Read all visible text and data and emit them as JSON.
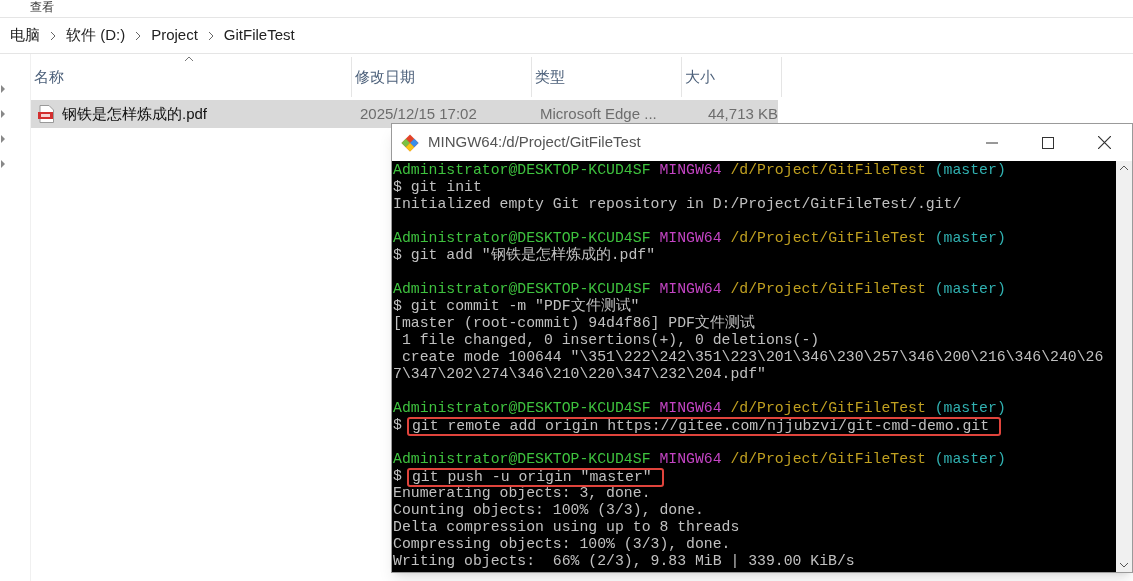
{
  "explorer": {
    "menu_label": "查看",
    "breadcrumbs": [
      "电脑",
      "软件 (D:)",
      "Project",
      "GitFileTest"
    ],
    "nav_items": [
      {
        "expanded": false
      },
      {
        "expanded": false
      },
      {
        "expanded": false
      },
      {
        "expanded": false
      }
    ],
    "columns": [
      {
        "label": "名称",
        "sorted": true
      },
      {
        "label": "修改日期",
        "sorted": false
      },
      {
        "label": "类型",
        "sorted": false
      },
      {
        "label": "大小",
        "sorted": false
      }
    ],
    "files": [
      {
        "name": "钢铁是怎样炼成的.pdf",
        "modified": "2025/12/15 17:02",
        "type": "Microsoft Edge ...",
        "size": "44,713 KB",
        "selected": true
      }
    ]
  },
  "terminal": {
    "title": "MINGW64:/d/Project/GitFileTest",
    "lines": [
      {
        "kind": "prompt",
        "user": "Administrator@DESKTOP-KCUD4SF",
        "system": "MINGW64",
        "path": "/d/Project/GitFileTest",
        "branch": "(master)"
      },
      {
        "kind": "command",
        "prompt": "$",
        "command": "git init",
        "highlighted": false
      },
      {
        "kind": "output",
        "text": "Initialized empty Git repository in D:/Project/GitFileTest/.git/"
      },
      {
        "kind": "blank"
      },
      {
        "kind": "prompt",
        "user": "Administrator@DESKTOP-KCUD4SF",
        "system": "MINGW64",
        "path": "/d/Project/GitFileTest",
        "branch": "(master)"
      },
      {
        "kind": "command",
        "prompt": "$",
        "command": "git add \"钢铁是怎样炼成的.pdf\"",
        "highlighted": false
      },
      {
        "kind": "blank"
      },
      {
        "kind": "prompt",
        "user": "Administrator@DESKTOP-KCUD4SF",
        "system": "MINGW64",
        "path": "/d/Project/GitFileTest",
        "branch": "(master)"
      },
      {
        "kind": "command",
        "prompt": "$",
        "command": "git commit -m \"PDF文件测试\"",
        "highlighted": false
      },
      {
        "kind": "output",
        "text": "[master (root-commit) 94d4f86] PDF文件测试"
      },
      {
        "kind": "output",
        "text": " 1 file changed, 0 insertions(+), 0 deletions(-)"
      },
      {
        "kind": "output",
        "text": " create mode 100644 \"\\351\\222\\242\\351\\223\\201\\346\\230\\257\\346\\200\\216\\346\\240\\26"
      },
      {
        "kind": "output",
        "text": "7\\347\\202\\274\\346\\210\\220\\347\\232\\204.pdf\""
      },
      {
        "kind": "blank"
      },
      {
        "kind": "prompt",
        "user": "Administrator@DESKTOP-KCUD4SF",
        "system": "MINGW64",
        "path": "/d/Project/GitFileTest",
        "branch": "(master)"
      },
      {
        "kind": "command",
        "prompt": "$",
        "command": "git remote add origin https://gitee.com/njjubzvi/git-cmd-demo.git",
        "highlighted": true
      },
      {
        "kind": "blank"
      },
      {
        "kind": "prompt",
        "user": "Administrator@DESKTOP-KCUD4SF",
        "system": "MINGW64",
        "path": "/d/Project/GitFileTest",
        "branch": "(master)"
      },
      {
        "kind": "command",
        "prompt": "$",
        "command": "git push -u origin \"master\"",
        "highlighted": true
      },
      {
        "kind": "output",
        "text": "Enumerating objects: 3, done."
      },
      {
        "kind": "output",
        "text": "Counting objects: 100% (3/3), done."
      },
      {
        "kind": "output",
        "text": "Delta compression using up to 8 threads"
      },
      {
        "kind": "output",
        "text": "Compressing objects: 100% (3/3), done."
      },
      {
        "kind": "output",
        "text": "Writing objects:  66% (2/3), 9.83 MiB | 339.00 KiB/s"
      }
    ]
  }
}
